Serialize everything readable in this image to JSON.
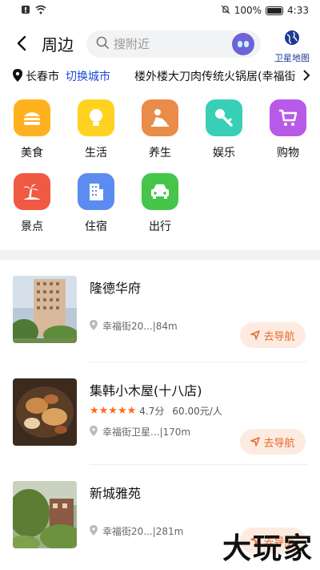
{
  "status": {
    "battery": "100%",
    "time": "4:33"
  },
  "header": {
    "title": "周边",
    "search_placeholder": "搜附近",
    "satellite_label": "卫星地图"
  },
  "location": {
    "city": "长春市",
    "switch_label": "切换城市",
    "address": "楼外楼大刀肉传统火锅居(幸福街"
  },
  "categories": [
    {
      "label": "美食",
      "icon": "burger-icon",
      "color": "#ffb21f"
    },
    {
      "label": "生活",
      "icon": "lightbulb-icon",
      "color": "#ffd21f"
    },
    {
      "label": "养生",
      "icon": "massage-icon",
      "color": "#e98b49"
    },
    {
      "label": "娱乐",
      "icon": "key-icon",
      "color": "#38cfb7"
    },
    {
      "label": "购物",
      "icon": "cart-icon",
      "color": "#b85ae8"
    },
    {
      "label": "景点",
      "icon": "palm-icon",
      "color": "#f05a42"
    },
    {
      "label": "住宿",
      "icon": "building-icon",
      "color": "#5c8cf0"
    },
    {
      "label": "出行",
      "icon": "car-icon",
      "color": "#47c44a"
    }
  ],
  "places": [
    {
      "name": "隆德华府",
      "address": "幸福街20...",
      "distance": "|84m",
      "nav_label": "去导航",
      "rating": null,
      "price": null
    },
    {
      "name": "集韩小木屋(十八店)",
      "address": "幸福街卫星...",
      "distance": "|170m",
      "nav_label": "去导航",
      "rating": "4.7分",
      "price": "60.00元/人"
    },
    {
      "name": "新城雅苑",
      "address": "幸福街20...",
      "distance": "|281m",
      "nav_label": "去导航",
      "rating": null,
      "price": null
    }
  ],
  "watermark": "大玩家",
  "colors": {
    "accent_blue": "#1b4bd8",
    "nav_orange": "#e46b2c",
    "nav_bg": "#fdebe1",
    "star_orange": "#ff6b1a"
  }
}
